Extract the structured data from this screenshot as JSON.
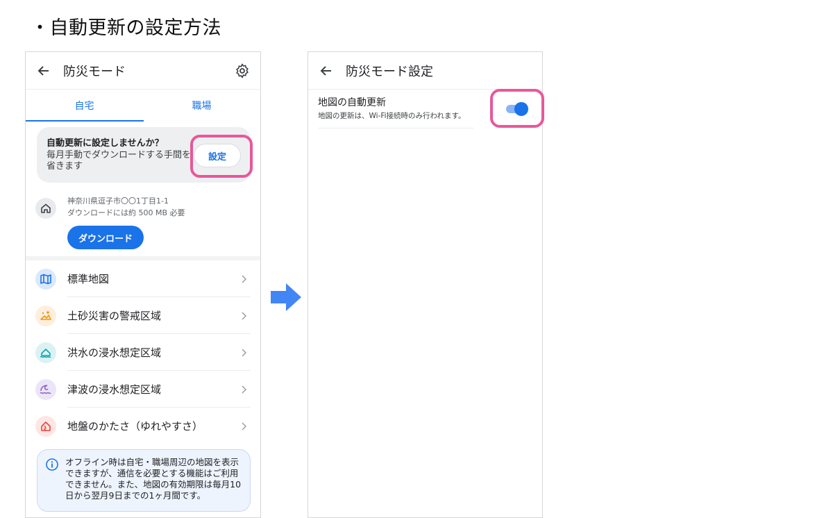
{
  "heading": "・自動更新の設定方法",
  "left": {
    "appbar_title": "防災モード",
    "tabs": [
      "自宅",
      "職場"
    ],
    "promo": {
      "title": "自動更新に設定しませんか？",
      "body": "毎月手動でダウンロードする手間を省きます",
      "button": "設定"
    },
    "location": {
      "address": "神奈川県逗子市〇〇1丁目1-1",
      "size": "ダウンロードには約 500 MB 必要",
      "download_button": "ダウンロード"
    },
    "items": [
      {
        "label": "標準地図",
        "icon": "map-icon",
        "color": "#1a73e8",
        "bg": "#dbe8fb"
      },
      {
        "label": "土砂災害の警戒区域",
        "icon": "landslide-icon",
        "color": "#f29900",
        "bg": "#fdeede"
      },
      {
        "label": "洪水の浸水想定区域",
        "icon": "flood-icon",
        "color": "#12a4af",
        "bg": "#dbf2f3"
      },
      {
        "label": "津波の浸水想定区域",
        "icon": "tsunami-icon",
        "color": "#8e63ce",
        "bg": "#ece5f7"
      },
      {
        "label": "地盤のかたさ（ゆれやすさ）",
        "icon": "ground-icon",
        "color": "#e8453c",
        "bg": "#fde6e4"
      }
    ],
    "notice": "オフライン時は自宅・職場周辺の地図を表示できますが、通信を必要とする機能はご利用できません。また、地図の有効期限は毎月10日から翌月9日までの1ヶ月間です。"
  },
  "right": {
    "appbar_title": "防災モード設定",
    "setting": {
      "title": "地図の自動更新",
      "description": "地図の更新は、Wi-Fi接続時のみ行われます。",
      "enabled": true
    }
  },
  "colors": {
    "accent": "#1a73e8",
    "highlight": "#e8579b",
    "arrow": "#4285f4"
  }
}
